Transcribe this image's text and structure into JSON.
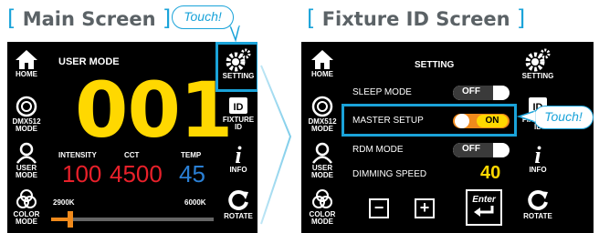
{
  "left": {
    "heading": "Main Screen",
    "callout": "Touch!",
    "mode_title": "USER MODE",
    "big_value": "001",
    "left_buttons": [
      "HOME",
      "DMX512 MODE",
      "USER MODE",
      "COLOR MODE"
    ],
    "right_buttons": [
      "SETTING",
      "FIXTURE ID",
      "INFO",
      "ROTATE"
    ],
    "params": [
      {
        "label": "INTENSITY",
        "value": "100",
        "color": "#e8202a"
      },
      {
        "label": "CCT",
        "value": "4500",
        "color": "#e8202a"
      },
      {
        "label": "TEMP",
        "value": "45",
        "color": "#2a7fd4"
      }
    ],
    "slider": {
      "min_label": "2900K",
      "max_label": "6000K",
      "level": 0.12
    }
  },
  "right": {
    "heading": "Fixture ID Screen",
    "callout": "Touch!",
    "title": "SETTING",
    "left_buttons": [
      "HOME",
      "DMX512 MODE",
      "USER MODE",
      "COLOR MODE"
    ],
    "right_buttons": [
      "SETTING",
      "FIXTURE ID",
      "INFO",
      "ROTATE"
    ],
    "rows": [
      {
        "label": "SLEEP MODE",
        "toggle": "OFF",
        "on": false
      },
      {
        "label": "MASTER SETUP",
        "toggle": "ON",
        "on": true
      },
      {
        "label": "RDM MODE",
        "toggle": "OFF",
        "on": false
      }
    ],
    "dimming_label": "DIMMING SPEED",
    "dimming_value": "40",
    "minus_label": "−",
    "plus_label": "+",
    "enter_label": "Enter"
  },
  "colors": {
    "accent": "#1aa3d9",
    "yellow": "#ffd800",
    "orange": "#f08a1c"
  }
}
